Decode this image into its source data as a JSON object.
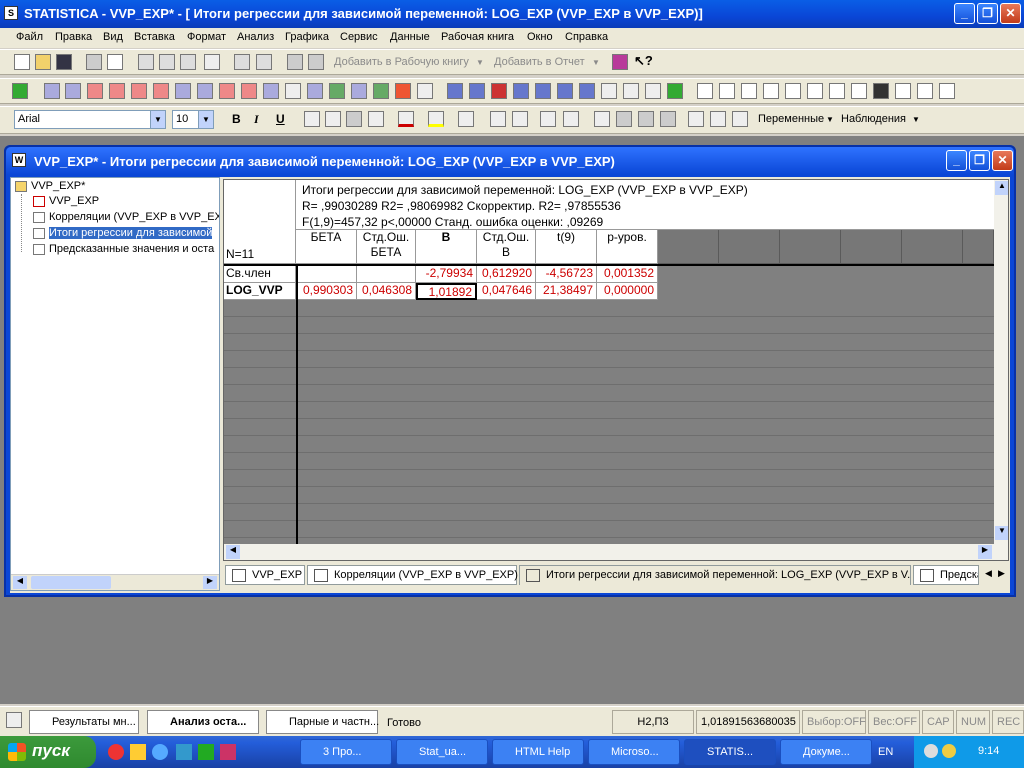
{
  "app": {
    "title": "STATISTICA - VVP_EXP* - [ Итоги регрессии для зависимой переменной: LOG_EXP (VVP_EXP в VVP_EXP)]"
  },
  "menu": [
    "Файл",
    "Правка",
    "Вид",
    "Вставка",
    "Формат",
    "Анализ",
    "Графика",
    "Сервис",
    "Данные",
    "Рабочая книга",
    "Окно",
    "Справка"
  ],
  "toolbar1": {
    "add_workbook": "Добавить в Рабочую книгу",
    "add_report": "Добавить в Отчет"
  },
  "toolbar3": {
    "font": "Arial",
    "size": "10",
    "bold": "B",
    "italic": "I",
    "underline": "U",
    "variables": "Переменные",
    "cases": "Наблюдения"
  },
  "docwindow": {
    "title": "VVP_EXP* - Итоги регрессии для зависимой переменной: LOG_EXP (VVP_EXP в VVP_EXP)"
  },
  "tree": {
    "root": "VVP_EXP*",
    "items": [
      "VVP_EXP",
      "Корреляции (VVP_EXP в VVP_EXP",
      "Итоги регрессии для зависимой",
      "Предсказанные значения и оста"
    ]
  },
  "sheet": {
    "header_lines": [
      "Итоги регрессии для зависимой переменной: LOG_EXP (VVP_EXP в VVP_EXP)",
      "R= ,99030289 R2= ,98069982 Скорректир. R2= ,97855536",
      "F(1,9)=457,32 p<,00000 Станд. ошибка оценки: ,09269"
    ],
    "n_label": "N=11",
    "columns": [
      "БЕТА",
      "Стд.Ош.\nБЕТА",
      "B",
      "Стд.Ош.\nB",
      "t(9)",
      "p-уров."
    ],
    "rows": [
      {
        "label": "Св.член",
        "values": [
          "",
          "",
          "-2,79934",
          "0,612920",
          "-4,56723",
          "0,001352"
        ]
      },
      {
        "label": "LOG_VVP",
        "values": [
          "0,990303",
          "0,046308",
          "1,01892",
          "0,047646",
          "21,38497",
          "0,000000"
        ]
      }
    ]
  },
  "tabs": [
    "VVP_EXP",
    "Корреляции (VVP_EXP в VVP_EXP)",
    "Итоги регрессии для зависимой переменной: LOG_EXP (VVP_EXP в V...",
    "Предска:"
  ],
  "status": {
    "results_btn": "Результаты мн...",
    "analysis_btn": "Анализ оста...",
    "paired_btn": "Парные и частн...",
    "ready": "Готово",
    "cell": "H2,П3",
    "value": "1,01891563680035",
    "sel": "Выбор:OFF",
    "weight": "Вес:OFF",
    "cap": "CAP",
    "num": "NUM",
    "rec": "REC"
  },
  "taskbar": {
    "start": "пуск",
    "items": [
      "3 Про...",
      "Stat_ua...",
      "HTML Help",
      "Microso...",
      "STATIS...",
      "Докуме..."
    ],
    "lang": "EN",
    "time": "9:14"
  }
}
